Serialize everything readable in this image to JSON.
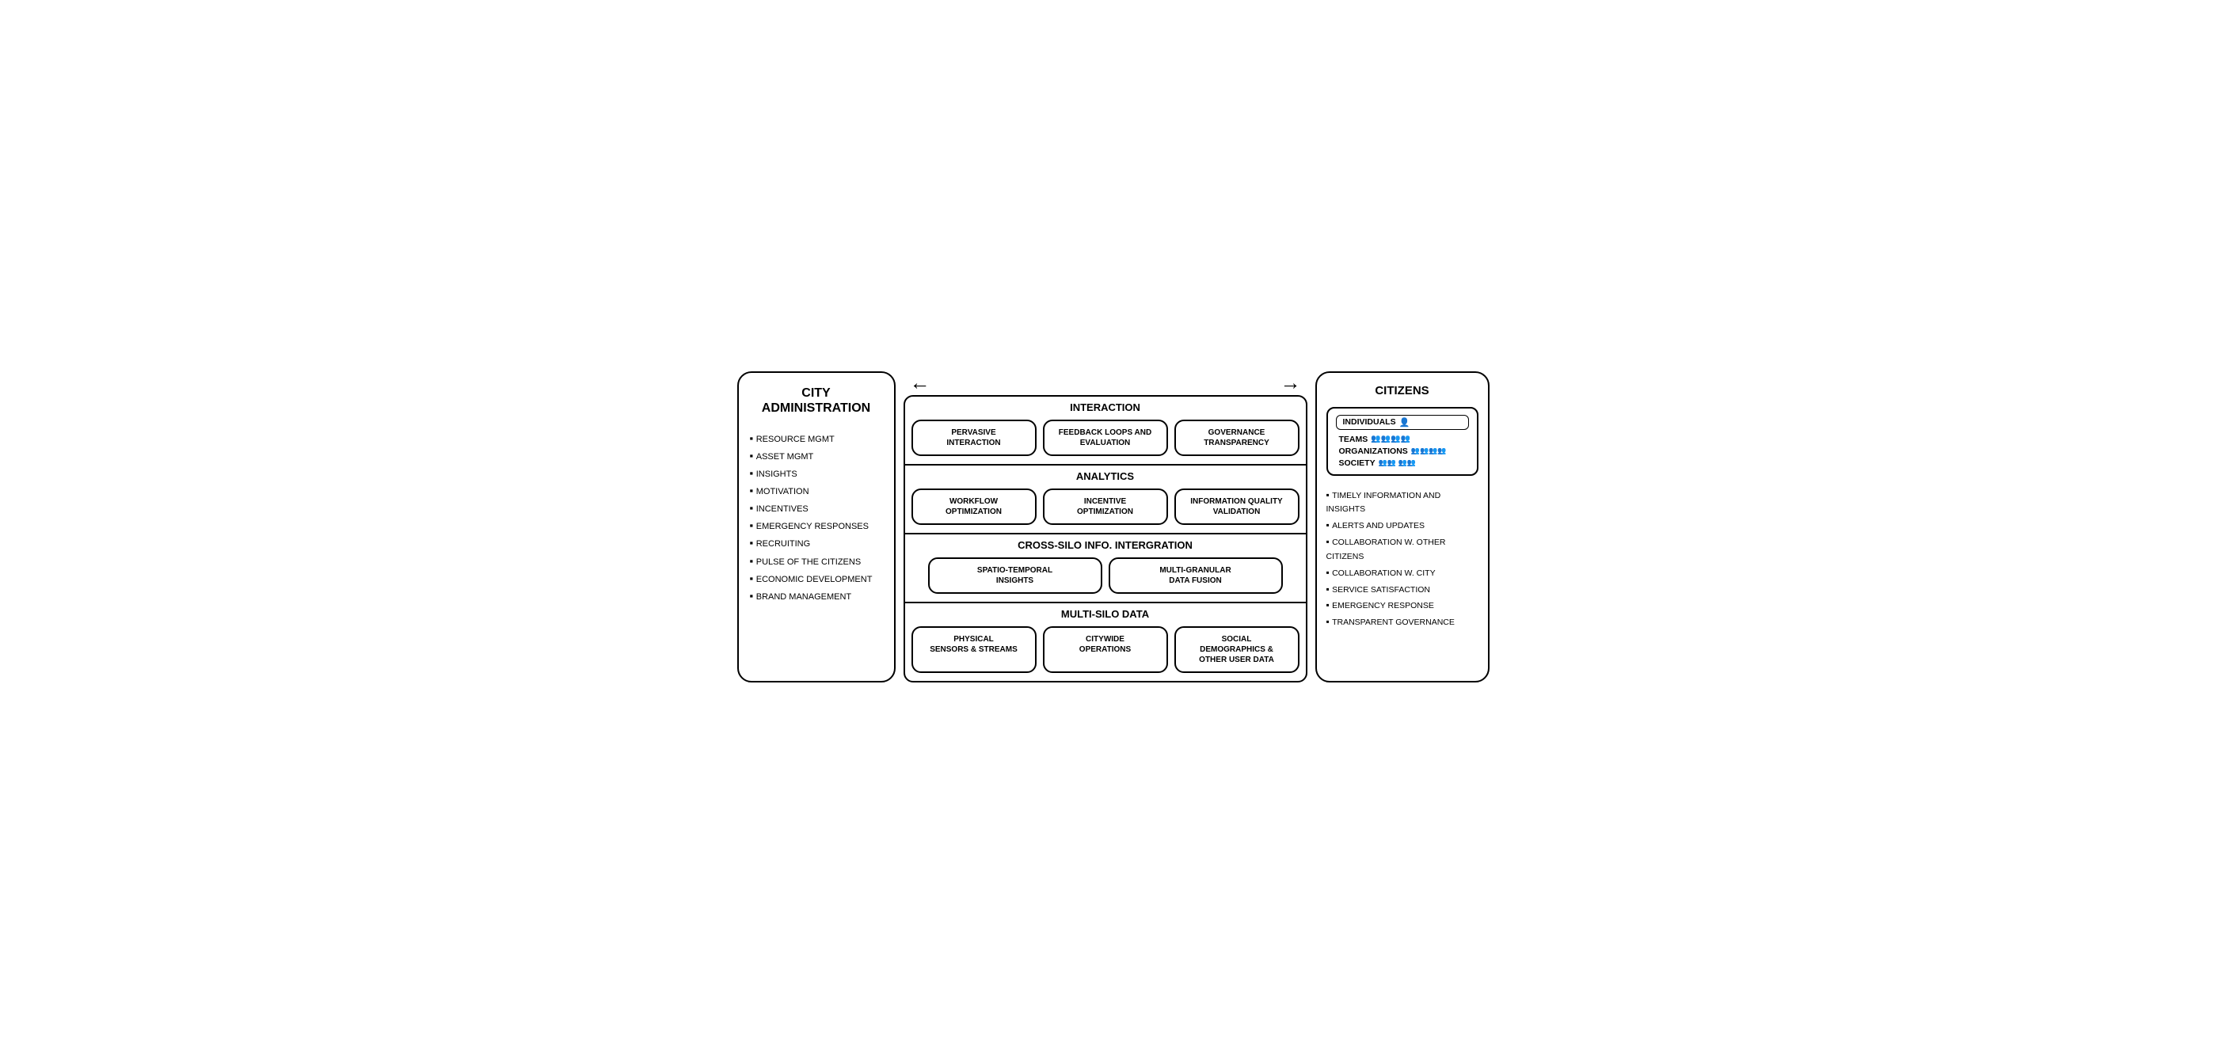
{
  "left_panel": {
    "title": "CITY\nADMINISTRATION",
    "items": [
      "RESOURCE MGMT",
      "ASSET MGMT",
      "INSIGHTS",
      "MOTIVATION",
      "INCENTIVES",
      "EMERGENCY RESPONSES",
      "RECRUITING",
      "PULSE OF THE CITIZENS",
      "ECONOMIC DEVELOPMENT",
      "BRAND MANAGEMENT"
    ]
  },
  "middle": {
    "interaction": {
      "title": "INTERACTION",
      "cards": [
        "PERVASIVE\nINTERACTION",
        "FEEDBACK LOOPS AND\nEVALUATION",
        "GOVERNANCE\nTRANSPARENCY"
      ]
    },
    "analytics": {
      "title": "ANALYTICS",
      "cards": [
        "WORKFLOW\nOPTIMIZATION",
        "INCENTIVE\nOPTIMIZATION",
        "INFORMATION QUALITY\nVALIDATION"
      ]
    },
    "crosssilo": {
      "title": "CROSS-SILO INFO. INTERGRATION",
      "cards": [
        "SPATIO-TEMPORAL\nINSIGHTS",
        "MULTI-GRANULAR\nDATA FUSION"
      ]
    },
    "multisilo": {
      "title": "MULTI-SILO DATA",
      "cards": [
        "PHYSICAL\nSENSORS & STREAMS",
        "CITYWIDE\nOPERATIONS",
        "SOCIAL\nDEMOGRAPHICS &\nOTHER USER DATA"
      ]
    }
  },
  "right_panel": {
    "title": "CITIZENS",
    "inner_box": {
      "rows": [
        {
          "label": "INDIVIDUALS",
          "icons": "👤",
          "bordered": true
        },
        {
          "label": "TEAMS",
          "icons": "👥👥",
          "bordered": false
        },
        {
          "label": "ORGANIZATIONS",
          "icons": "👥👥👥",
          "bordered": false
        },
        {
          "label": "SOCIETY",
          "icons": "👥👥 👥👥",
          "bordered": false
        }
      ]
    },
    "items": [
      "TIMELY INFORMATION AND INSIGHTS",
      "ALERTS AND UPDATES",
      "COLLABORATION W. OTHER CITIZENS",
      "COLLABORATION W. CITY",
      "SERVICE SATISFACTION",
      "EMERGENCY RESPONSE",
      "TRANSPARENT GOVERNANCE"
    ]
  },
  "arrows": {
    "left_arrow": "←",
    "right_arrow": "→"
  }
}
